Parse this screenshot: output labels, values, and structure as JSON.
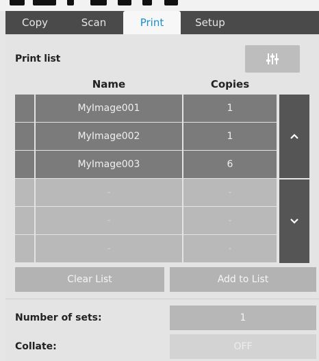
{
  "tabs": [
    {
      "label": "Copy"
    },
    {
      "label": "Scan"
    },
    {
      "label": "Print",
      "active": true
    },
    {
      "label": "Setup"
    }
  ],
  "print_list": {
    "title": "Print list",
    "settings_icon": "sliders-icon",
    "columns": {
      "name": "Name",
      "copies": "Copies"
    },
    "rows": [
      {
        "name": "MyImage001",
        "copies": "1"
      },
      {
        "name": "MyImage002",
        "copies": "1"
      },
      {
        "name": "MyImage003",
        "copies": "6"
      },
      {
        "name": "-",
        "copies": "-"
      },
      {
        "name": "-",
        "copies": "-"
      },
      {
        "name": "-",
        "copies": "-"
      }
    ],
    "scroll_up_icon": "chevron-up-icon",
    "scroll_down_icon": "chevron-down-icon"
  },
  "actions": {
    "clear": "Clear List",
    "add": "Add to List"
  },
  "settings": {
    "sets_label": "Number of sets:",
    "sets_value": "1",
    "collate_label": "Collate:",
    "collate_value": "OFF"
  },
  "colors": {
    "active_tab_text": "#1a8fc9",
    "tab_bar": "#4a4a4a",
    "scroll_button": "#555555"
  }
}
